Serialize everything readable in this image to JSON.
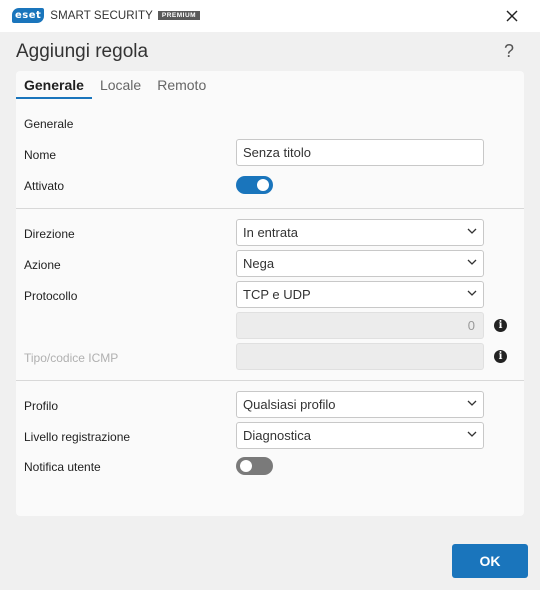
{
  "app": {
    "brand_logo": "eset",
    "brand_name": "SMART SECURITY",
    "brand_tier": "PREMIUM"
  },
  "dialog": {
    "title": "Aggiungi regola",
    "help_label": "?"
  },
  "tabs": [
    {
      "label": "Generale",
      "active": true
    },
    {
      "label": "Locale",
      "active": false
    },
    {
      "label": "Remoto",
      "active": false
    }
  ],
  "section_heading": "Generale",
  "form": {
    "name_label": "Nome",
    "name_value": "Senza titolo",
    "enabled_label": "Attivato",
    "enabled": true,
    "direction_label": "Direzione",
    "direction_value": "In entrata",
    "action_label": "Azione",
    "action_value": "Nega",
    "protocol_label": "Protocollo",
    "protocol_value": "TCP e UDP",
    "protocol_number_value": "0",
    "icmp_label": "Tipo/codice ICMP",
    "icmp_value": "",
    "profile_label": "Profilo",
    "profile_value": "Qualsiasi profilo",
    "log_label": "Livello registrazione",
    "log_value": "Diagnostica",
    "notify_label": "Notifica utente",
    "notify": false
  },
  "footer": {
    "ok_label": "OK"
  },
  "colors": {
    "accent": "#1a75bc",
    "toggle_off": "#7a7a7a"
  },
  "icons": {
    "close": "close-icon",
    "help": "question-mark-icon",
    "dropdown": "chevron-down-icon",
    "info": "info-icon"
  }
}
